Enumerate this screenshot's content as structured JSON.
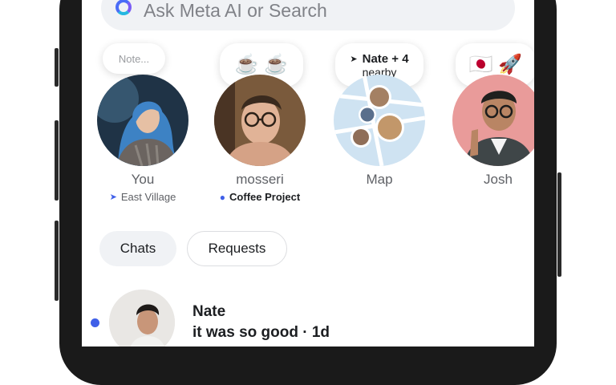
{
  "search": {
    "placeholder": "Ask Meta AI or Search"
  },
  "stories": [
    {
      "name": "You",
      "note": "Note...",
      "location": "East Village"
    },
    {
      "name": "mosseri",
      "note_emoji": "☕ ☕",
      "location": "Coffee Project"
    },
    {
      "name": "Map",
      "note_title": "Nate + 4",
      "note_sub": "nearby"
    },
    {
      "name": "Josh",
      "note_emoji": "🇯🇵 🚀"
    }
  ],
  "tabs": [
    {
      "label": "Chats",
      "selected": true
    },
    {
      "label": "Requests",
      "selected": false
    }
  ],
  "chats": [
    {
      "name": "Nate",
      "preview": "it was so good · 1d",
      "unread": true
    }
  ],
  "colors": {
    "accent": "#3f5fe8",
    "pill_bg": "#f0f2f5",
    "muted_text": "#5f6166"
  }
}
